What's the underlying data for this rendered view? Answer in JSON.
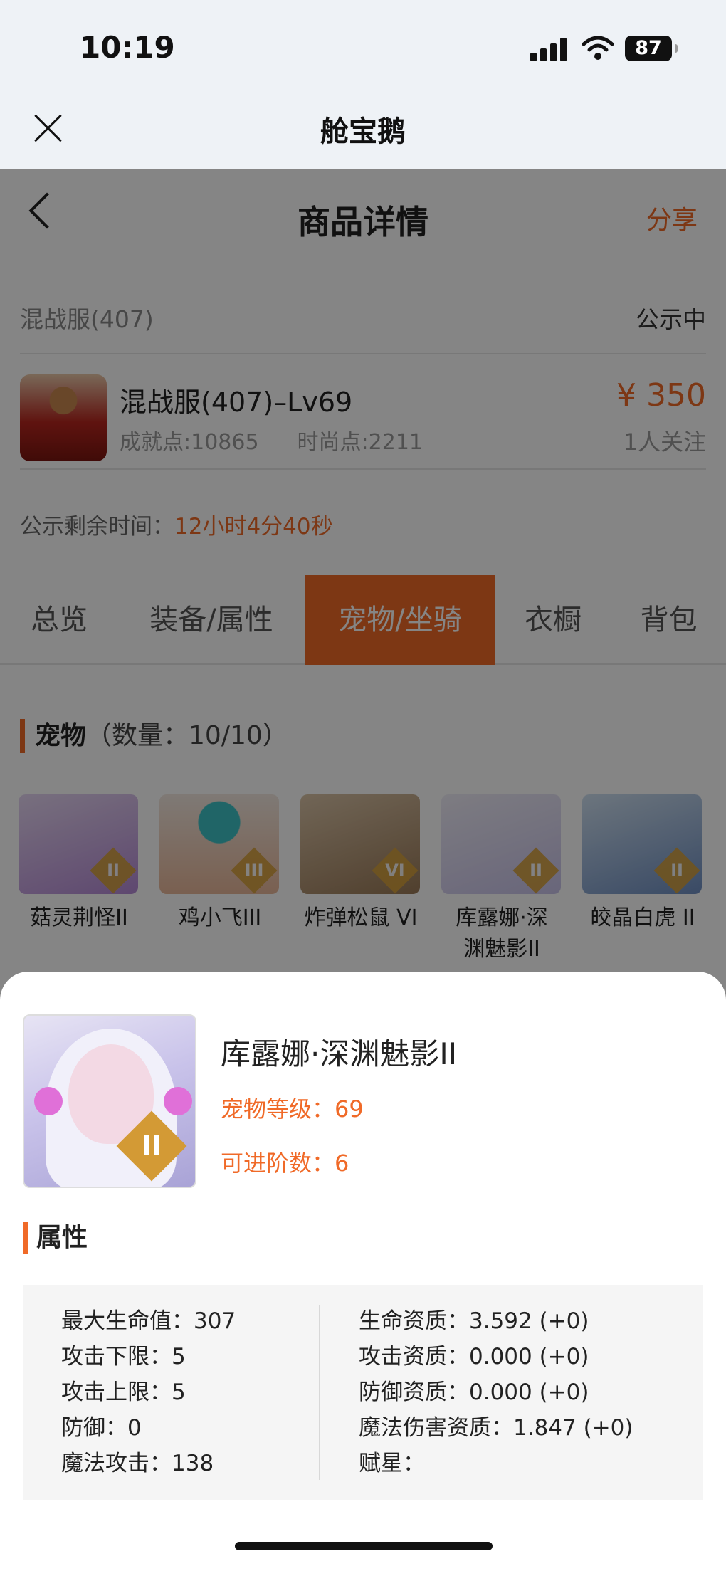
{
  "status_bar": {
    "time": "10:19",
    "battery": "87"
  },
  "miniprogram": {
    "title": "舱宝鹅"
  },
  "nav": {
    "title": "商品详情",
    "share": "分享"
  },
  "listing": {
    "server": "混战服(407)",
    "status": "公示中",
    "character_name": "混战服(407)–Lv69",
    "achievement": "成就点:10865",
    "fashion": "时尚点:2211",
    "price": "¥ 350",
    "followers": "1人关注",
    "remain_label": "公示剩余时间：",
    "remain_value": "12小时4分40秒"
  },
  "tabs": [
    {
      "label": "总览",
      "active": false
    },
    {
      "label": "装备/属性",
      "active": false
    },
    {
      "label": "宠物/坐骑",
      "active": true
    },
    {
      "label": "衣橱",
      "active": false
    },
    {
      "label": "背包",
      "active": false
    }
  ],
  "pets_section": {
    "title": "宠物",
    "count": "（数量：10/10）",
    "pets": [
      {
        "name": "菇灵荆怪II",
        "badge": "II",
        "color": "#b58ad6"
      },
      {
        "name": "鸡小飞III",
        "badge": "III",
        "color": "#e9b89a"
      },
      {
        "name": "炸弹松鼠 VI",
        "badge": "VI",
        "color": "#9a7a58"
      },
      {
        "name": "库露娜·深\n渊魅影II",
        "badge": "II",
        "color": "#c9c3ea"
      },
      {
        "name": "皎晶白虎 II",
        "badge": "II",
        "color": "#6f8fc2"
      }
    ]
  },
  "sheet": {
    "pet_name": "库露娜·深渊魅影II",
    "badge": "II",
    "level": "宠物等级：69",
    "advance": "可进阶数：6",
    "attr_title": "属性",
    "left_attrs": [
      "最大生命值：307",
      "攻击下限：5",
      "攻击上限：5",
      "防御：0",
      "魔法攻击：138"
    ],
    "right_attrs": [
      "生命资质：3.592 (+0)",
      "攻击资质：0.000 (+0)",
      "防御资质：0.000 (+0)",
      "魔法伤害资质：1.847 (+0)",
      "赋星："
    ]
  },
  "colors": {
    "accent": "#f06a28",
    "overlay": "rgba(0,0,0,0.48)"
  }
}
